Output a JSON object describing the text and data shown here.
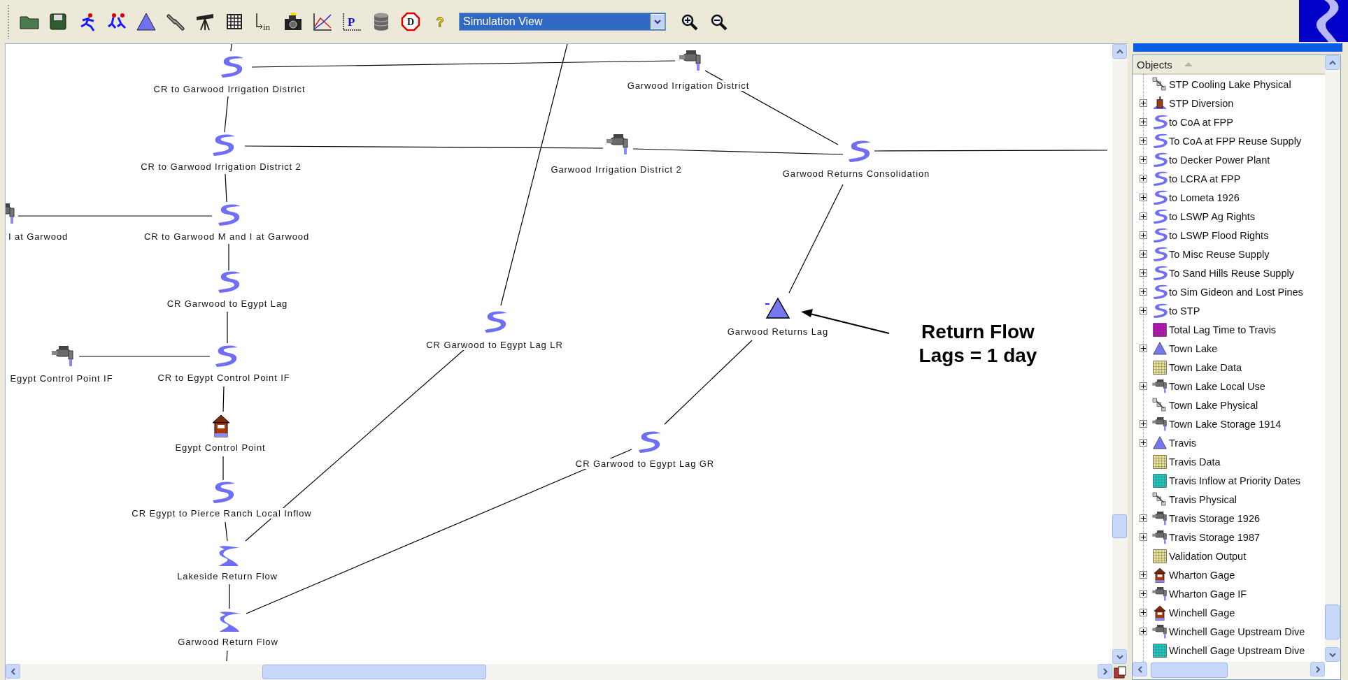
{
  "toolbar": {
    "buttons": [
      {
        "kind": "open"
      },
      {
        "kind": "save"
      },
      {
        "kind": "run"
      },
      {
        "kind": "run-multiple"
      },
      {
        "kind": "triangle"
      },
      {
        "kind": "link"
      },
      {
        "kind": "telescope"
      },
      {
        "kind": "grid"
      },
      {
        "kind": "input",
        "glyph": "in"
      },
      {
        "kind": "camera"
      },
      {
        "kind": "chart"
      },
      {
        "kind": "plot",
        "glyph": "P"
      },
      {
        "kind": "database"
      },
      {
        "kind": "stop",
        "glyph": "D"
      },
      {
        "kind": "help",
        "glyph": "?"
      }
    ],
    "view_select": {
      "value": "Simulation View"
    },
    "zoom_buttons": [
      {
        "kind": "zoom-in"
      },
      {
        "kind": "zoom-out"
      }
    ]
  },
  "canvas": {
    "nodes": [
      {
        "label": "CR to Garwood Irrigation District",
        "kind": "reach"
      },
      {
        "label": "CR to Garwood Irrigation District 2",
        "kind": "reach"
      },
      {
        "label": "I at Garwood",
        "kind": "diversion"
      },
      {
        "label": "CR to Garwood M and I at Garwood",
        "kind": "reach"
      },
      {
        "label": "CR Garwood to Egypt Lag",
        "kind": "reach"
      },
      {
        "label": "Egypt Control Point IF",
        "kind": "diversion"
      },
      {
        "label": "CR to Egypt Control Point IF",
        "kind": "reach"
      },
      {
        "label": "Egypt Control Point",
        "kind": "gage"
      },
      {
        "label": "CR Egypt to Pierce Ranch Local Inflow",
        "kind": "reach"
      },
      {
        "label": "Lakeside Return Flow",
        "kind": "return"
      },
      {
        "label": "Garwood Return Flow",
        "kind": "return"
      },
      {
        "label": "CR Garwood to Egypt Lag LR",
        "kind": "reach"
      },
      {
        "label": "Garwood Irrigation District",
        "kind": "diversion"
      },
      {
        "label": "Garwood Irrigation District 2",
        "kind": "diversion"
      },
      {
        "label": "Garwood Returns Consolidation",
        "kind": "reach"
      },
      {
        "label": "Garwood Returns Lag",
        "kind": "lag"
      },
      {
        "label": "CR Garwood to Egypt Lag GR",
        "kind": "reach"
      }
    ],
    "annotation": {
      "lines": [
        "Return Flow",
        "Lags = 1 day"
      ]
    }
  },
  "objects_panel": {
    "header": "Objects",
    "items": [
      {
        "label": "STP Cooling Lake Physical",
        "kind": "physical",
        "expandable": false
      },
      {
        "label": "STP Diversion",
        "kind": "pump",
        "expandable": true
      },
      {
        "label": "to CoA at FPP",
        "kind": "reach",
        "expandable": true
      },
      {
        "label": "To CoA at FPP Reuse Supply",
        "kind": "reach",
        "expandable": true
      },
      {
        "label": "to Decker Power Plant",
        "kind": "reach",
        "expandable": true
      },
      {
        "label": "to LCRA at FPP",
        "kind": "reach",
        "expandable": true
      },
      {
        "label": "to Lometa 1926",
        "kind": "reach",
        "expandable": true
      },
      {
        "label": "to LSWP Ag Rights",
        "kind": "reach",
        "expandable": true
      },
      {
        "label": "to LSWP Flood Rights",
        "kind": "reach",
        "expandable": true
      },
      {
        "label": "To Misc Reuse Supply",
        "kind": "reach",
        "expandable": true
      },
      {
        "label": "To Sand Hills Reuse Supply",
        "kind": "reach",
        "expandable": true
      },
      {
        "label": "to Sim Gideon and Lost Pines",
        "kind": "reach",
        "expandable": true
      },
      {
        "label": "to STP",
        "kind": "reach",
        "expandable": true
      },
      {
        "label": "Total Lag Time to Travis",
        "kind": "table",
        "color": "#c000c0",
        "expandable": false
      },
      {
        "label": "Town Lake",
        "kind": "reservoir",
        "expandable": true
      },
      {
        "label": "Town Lake Data",
        "kind": "table",
        "color": "#f0e890",
        "expandable": false
      },
      {
        "label": "Town Lake Local Use",
        "kind": "diversion",
        "expandable": true
      },
      {
        "label": "Town Lake Physical",
        "kind": "physical",
        "expandable": false
      },
      {
        "label": "Town Lake Storage 1914",
        "kind": "diversion",
        "expandable": true
      },
      {
        "label": "Travis",
        "kind": "reservoir",
        "expandable": true
      },
      {
        "label": "Travis Data",
        "kind": "table",
        "color": "#f0e890",
        "expandable": false
      },
      {
        "label": "Travis Inflow at Priority Dates",
        "kind": "table",
        "color": "#10d0c8",
        "expandable": false
      },
      {
        "label": "Travis Physical",
        "kind": "physical",
        "expandable": false
      },
      {
        "label": "Travis Storage 1926",
        "kind": "diversion",
        "expandable": true
      },
      {
        "label": "Travis Storage 1987",
        "kind": "diversion",
        "expandable": true
      },
      {
        "label": "Validation Output",
        "kind": "table",
        "color": "#f0e890",
        "expandable": false
      },
      {
        "label": "Wharton Gage",
        "kind": "gage",
        "expandable": true
      },
      {
        "label": "Wharton Gage IF",
        "kind": "diversion",
        "expandable": true
      },
      {
        "label": "Winchell Gage",
        "kind": "gage",
        "expandable": true
      },
      {
        "label": "Winchell Gage Upstream Dive",
        "kind": "diversion",
        "expandable": true
      },
      {
        "label": "Winchell Gage Upstream Dive",
        "kind": "table",
        "color": "#10d0c8",
        "expandable": false
      }
    ]
  }
}
